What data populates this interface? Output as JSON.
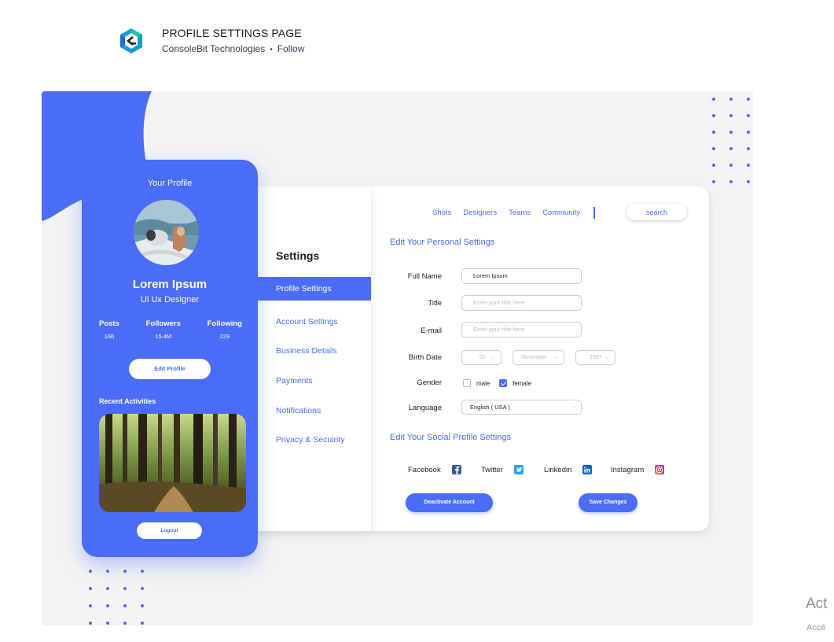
{
  "header": {
    "title": "PROFILE SETTINGS PAGE",
    "author": "ConsoleBit Technologies",
    "separator": "•",
    "follow": "Follow"
  },
  "profile": {
    "heading": "Your Profile",
    "name": "Lorem Ipsum",
    "role": "Ui Ux Designer",
    "stats": [
      {
        "label": "Posts",
        "value": "166"
      },
      {
        "label": "Followers",
        "value": "15.4M"
      },
      {
        "label": "Following",
        "value": "229"
      }
    ],
    "edit_label": "Edit Profile",
    "recent_label": "Recent Activities",
    "logout_label": "Logout"
  },
  "menu": {
    "title": "Settings",
    "items": [
      {
        "label": "Profile Settings"
      },
      {
        "label": "Account Settings"
      },
      {
        "label": "Business Details"
      },
      {
        "label": "Payments"
      },
      {
        "label": "Notifications"
      },
      {
        "label": "Privacy & Secuirity"
      }
    ]
  },
  "nav": {
    "links": [
      "Shots",
      "Designers",
      "Teams",
      "Community"
    ],
    "search_placeholder": "search"
  },
  "form": {
    "section_title": "Edit Your Personal Settings",
    "full_name_label": "Full Name",
    "full_name_value": "Lorem Ipsum",
    "title_label": "Title",
    "title_placeholder": "Enter your title here",
    "email_label": "E-mail",
    "email_placeholder": "Enter your title here",
    "birth_label": "Birth Date",
    "birth_day": "01",
    "birth_month": "November",
    "birth_year": "1997",
    "gender_label": "Gender",
    "gender_male": "male",
    "gender_female": "female",
    "language_label": "Language",
    "language_value": "English ( USA )"
  },
  "social": {
    "section_title": "Edit Your Social Profile Settings",
    "facebook": "Facebook",
    "twitter": "Twitter",
    "linkedin": "Linkedin",
    "instagram": "Instagram"
  },
  "actions": {
    "deactivate": "Deactivate Account",
    "save": "Save Changes"
  },
  "watermark": {
    "line1": "Act",
    "line2": "Accé"
  },
  "colors": {
    "accent": "#4b6cf7",
    "canvas": "#f3f3f3"
  }
}
